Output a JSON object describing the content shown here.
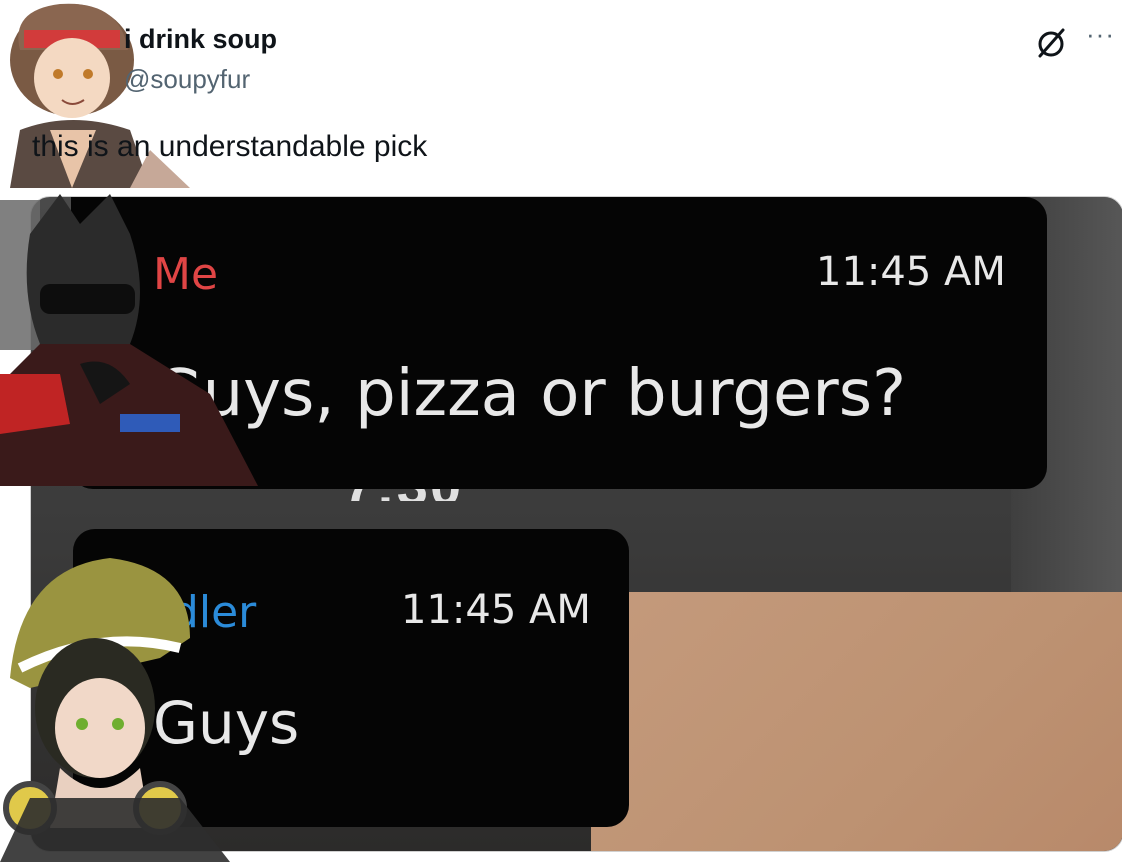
{
  "tweet": {
    "display_name": "i drink soup",
    "handle": "@soupyfur",
    "text": "this is an understandable pick",
    "icons": [
      "avatar-image",
      "grok-icon",
      "more-icon"
    ]
  },
  "more_glyph": "···",
  "media": {
    "under_text": "7:30",
    "messages": [
      {
        "sender": "Me",
        "time": "11:45 AM",
        "text": "Guys, pizza or burgers?",
        "sender_color": "#e04545"
      },
      {
        "sender": "ddler",
        "time": "11:45 AM",
        "text": "Guys",
        "sender_color": "#2b8bd9"
      }
    ]
  }
}
